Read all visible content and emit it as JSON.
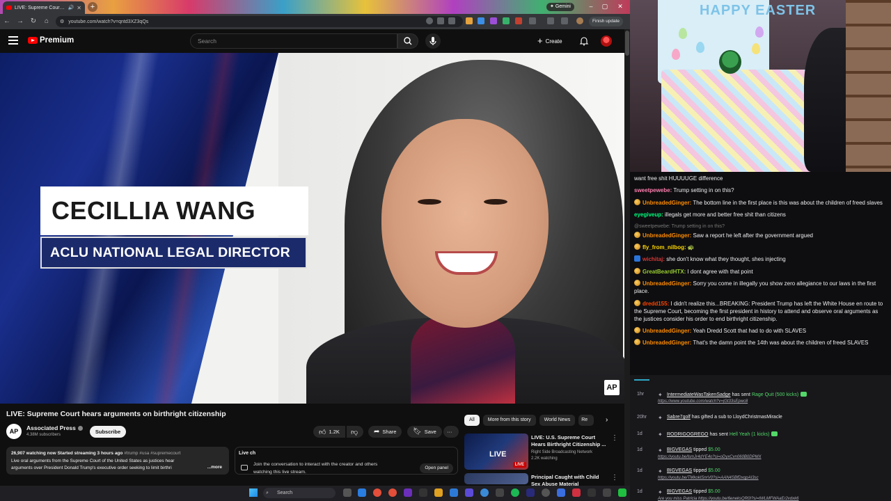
{
  "browser": {
    "tab_title": "LIVE: Supreme Court hears",
    "gemini_label": "Gemini",
    "url": "youtube.com/watch?v=qntd3XZ3qQs",
    "finish_update_label": "Finish update"
  },
  "youtube": {
    "logo_text": "Premium",
    "search_placeholder": "Search",
    "create_label": "Create"
  },
  "video": {
    "lower_third_name": "CECILLIA WANG",
    "lower_third_title": "ACLU NATIONAL LEGAL DIRECTOR",
    "watermark": "AP",
    "title": "LIVE: Supreme Court hears arguments on birthright citizenship",
    "channel_initials": "AP",
    "channel_name": "Associated Press",
    "channel_subs": "4.38M subscribers",
    "subscribe_label": "Subscribe",
    "likes": "1.2K",
    "share_label": "Share",
    "save_label": "Save",
    "more_actions": "···"
  },
  "description": {
    "meta": "26,907 watching now  Started streaming 3 hours ago",
    "tags": "#trump #usa #supremecourt",
    "line1": "Live oral arguments from the Supreme Court of the United States as justices hear",
    "line2": "arguments over President Donald Trump's executive order seeking to limit birthri",
    "more_label": "...more"
  },
  "live_chat_panel": {
    "title": "Live ch",
    "text_line1": "Join the conversation to interact with the creator and others",
    "text_line2": "watching this live stream.",
    "open_label": "Open panel"
  },
  "filter_chips": [
    "All",
    "More from this story",
    "World News",
    "Re"
  ],
  "recommendations": [
    {
      "title": "LIVE: U.S. Supreme Court Hears Birthright Citizenship ...",
      "channel": "Right Side Broadcasting Network",
      "meta": "2.2K watching",
      "thumb_text": "LIVE",
      "badge": "LIVE"
    },
    {
      "title": "Principal Caught with Child Sex Abuse Material",
      "channel": "",
      "meta": "",
      "thumb_text": "",
      "badge": ""
    }
  ],
  "taskbar": {
    "search_label": "Search"
  },
  "webcam": {
    "poster_text": "HAPPY EASTER"
  },
  "chat": [
    {
      "user": "",
      "color": "#efeff1",
      "badge": "",
      "text": "want free shit HUUUUGE difference",
      "reply": ""
    },
    {
      "user": "sweetpewebe:",
      "color": "#ff7fb0",
      "badge": "",
      "text": " Trump setting in on this?",
      "reply": ""
    },
    {
      "user": "UnbreadedGinger:",
      "color": "#ff8c00",
      "badge": "coin",
      "text": " The bottom line in the first place is this was about the children of freed slaves",
      "reply": ""
    },
    {
      "user": "eyegiveup:",
      "color": "#00ff7f",
      "badge": "",
      "text": " illegals get more and better free shit than citizens",
      "reply": ""
    },
    {
      "user": "",
      "color": "#777",
      "badge": "",
      "text": "",
      "reply": "@sweetpewebe: Trump setting in on this?"
    },
    {
      "user": "UnbreadedGinger:",
      "color": "#ff8c00",
      "badge": "coin",
      "text": " Saw a report he left after the government argued",
      "reply": ""
    },
    {
      "user": "fly_from_nilbog:",
      "color": "#ffd700",
      "badge": "coin",
      "text": " 🐢",
      "reply": ""
    },
    {
      "user": "wichitaj:",
      "color": "#d23838",
      "badge": "blue",
      "text": " she don't know what they thought, shes injecting",
      "reply": ""
    },
    {
      "user": "GreatBeardHTX:",
      "color": "#9acd32",
      "badge": "coin",
      "text": " I dont agree with that point",
      "reply": ""
    },
    {
      "user": "UnbreadedGinger:",
      "color": "#ff8c00",
      "badge": "coin",
      "text": " Sorry you come in illegally you show zero allegiance to our laws in the first place.",
      "reply": ""
    },
    {
      "user": "dredd155:",
      "color": "#ff4500",
      "badge": "coin",
      "text": " I didn't realize this...BREAKING: President Trump has left the White House en route to the Supreme Court, becoming the first president in history to attend and observe oral arguments as the justices consider his order to end birthright citizenship.",
      "reply": ""
    },
    {
      "user": "UnbreadedGinger:",
      "color": "#ff8c00",
      "badge": "coin",
      "text": " Yeah Dredd Scott that had to do with SLAVES",
      "reply": ""
    },
    {
      "user": "UnbreadedGinger:",
      "color": "#ff8c00",
      "badge": "coin",
      "text": " That's the damn point the 14th was about the children of freed SLAVES",
      "reply": ""
    }
  ],
  "events": [
    {
      "time": "1hr",
      "user": "IntermediateWasTakenSadge",
      "action": " has sent ",
      "gift": "Rage Quit (500 kicks)",
      "link": "https://www.youtube.com/watch?v=jGt33sEpwc8"
    },
    {
      "time": "20hr",
      "user": "Sabre7golf",
      "action": " has gifted a sub to ",
      "gift": "LloydChristmasMiracle",
      "link": ""
    },
    {
      "time": "1d",
      "user": "RODRIGOGREGO",
      "action": " has sent ",
      "gift": "Hell Yeah (1 kicks)",
      "link": ""
    },
    {
      "time": "1d",
      "user": "BIGVEGAS",
      "action": " tipped ",
      "gift": "$5.00",
      "link": "https://youtu.be/lsmJr4dYE4o?si=oDyxCvn060B0DPMX"
    },
    {
      "time": "1d",
      "user": "BIGVEGAS",
      "action": " tipped ",
      "gift": "$5.00",
      "link": "https://youtu.be/TMkokISnrV0?si=AAN4SBfDxqpAI3sc"
    },
    {
      "time": "1d",
      "user": "BIGVEGAS",
      "action": " tipped ",
      "gift": "$5.00",
      "link": "Are you miss Patricia https://youtu.be/6eneksQR0I?si=tWLMFWAaEr2vdxk6"
    }
  ]
}
